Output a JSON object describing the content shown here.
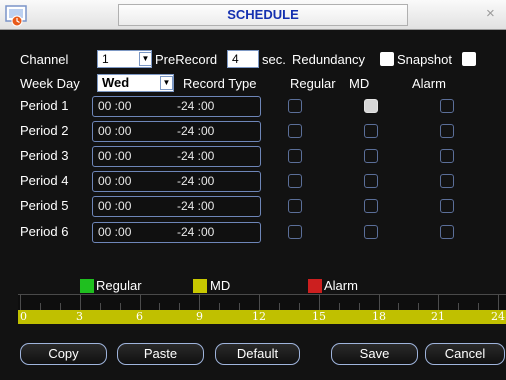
{
  "window": {
    "title": "SCHEDULE",
    "close_glyph": "×"
  },
  "channel": {
    "label": "Channel",
    "value": "1"
  },
  "prerecord": {
    "label": "PreRecord",
    "value": "4",
    "unit": "sec."
  },
  "redundancy": {
    "label": "Redundancy"
  },
  "snapshot": {
    "label": "Snapshot"
  },
  "weekday": {
    "label": "Week Day",
    "value": "Wed"
  },
  "columns": {
    "record_type": "Record Type",
    "regular": "Regular",
    "md": "MD",
    "alarm": "Alarm"
  },
  "periods": [
    {
      "label": "Period 1",
      "start": "00 :00",
      "end": "-24 :00",
      "regular": false,
      "md": true,
      "alarm": false
    },
    {
      "label": "Period 2",
      "start": "00 :00",
      "end": "-24 :00",
      "regular": false,
      "md": false,
      "alarm": false
    },
    {
      "label": "Period 3",
      "start": "00 :00",
      "end": "-24 :00",
      "regular": false,
      "md": false,
      "alarm": false
    },
    {
      "label": "Period 4",
      "start": "00 :00",
      "end": "-24 :00",
      "regular": false,
      "md": false,
      "alarm": false
    },
    {
      "label": "Period 5",
      "start": "00 :00",
      "end": "-24 :00",
      "regular": false,
      "md": false,
      "alarm": false
    },
    {
      "label": "Period 6",
      "start": "00 :00",
      "end": "-24 :00",
      "regular": false,
      "md": false,
      "alarm": false
    }
  ],
  "legend": [
    {
      "label": "Regular",
      "color": "#1fbf1f"
    },
    {
      "label": "MD",
      "color": "#c8c800"
    },
    {
      "label": "Alarm",
      "color": "#cc1f1f"
    }
  ],
  "timeline": {
    "bar_color": "#c0c000",
    "ticks": [
      "0",
      "3",
      "6",
      "9",
      "12",
      "15",
      "18",
      "21",
      "24"
    ]
  },
  "buttons": {
    "copy": "Copy",
    "paste": "Paste",
    "default": "Default",
    "save": "Save",
    "cancel": "Cancel"
  }
}
